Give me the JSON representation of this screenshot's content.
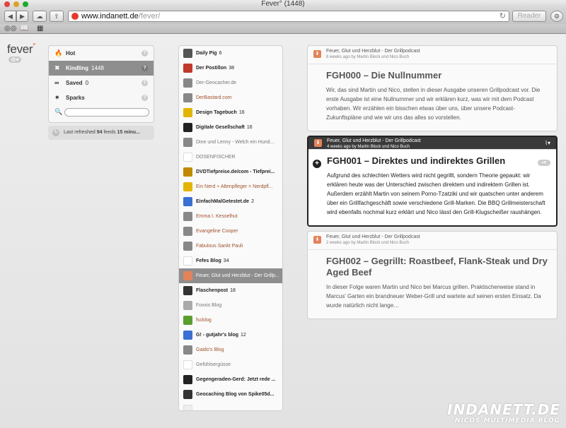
{
  "window": {
    "title": "Fever° (1448)",
    "url_host": "www.indanett.de",
    "url_path": "/fever/",
    "reader_label": "Reader"
  },
  "app": {
    "logo_text": "fever",
    "logo_mark": "°"
  },
  "nav": {
    "items": [
      {
        "label": "Hot",
        "icon": "flame-icon",
        "count": ""
      },
      {
        "label": "Kindling",
        "icon": "kindling-icon",
        "count": "1448"
      },
      {
        "label": "Saved",
        "icon": "saved-icon",
        "count": "0"
      },
      {
        "label": "Sparks",
        "icon": "sparks-icon",
        "count": ""
      }
    ],
    "help_glyph": "?",
    "search_placeholder": ""
  },
  "refresh": {
    "prefix": "Last refreshed ",
    "count": "94",
    "middle": " feeds ",
    "time": "15 minu..."
  },
  "feeds": [
    {
      "name": "Daily Pig",
      "count": "6",
      "bold": true,
      "style": "",
      "icon_color": "#555"
    },
    {
      "name": "Der Postillon",
      "count": "38",
      "bold": true,
      "style": "",
      "icon_color": "#c0392b"
    },
    {
      "name": "Der-Geocacher.de",
      "count": "",
      "bold": false,
      "style": "muted",
      "icon_color": "#888"
    },
    {
      "name": "DerBastard.com",
      "count": "",
      "bold": false,
      "style": "link",
      "icon_color": "#888"
    },
    {
      "name": "Design Tagebuch",
      "count": "16",
      "bold": true,
      "style": "",
      "icon_color": "#e2b400"
    },
    {
      "name": "Digitale Gesellschaft",
      "count": "16",
      "bold": true,
      "style": "",
      "icon_color": "#222"
    },
    {
      "name": "Dine und Lenny - Welch ein Hund...",
      "count": "",
      "bold": false,
      "style": "muted",
      "icon_color": "#888"
    },
    {
      "name": "DOSENFISCHER",
      "count": "",
      "bold": false,
      "style": "muted",
      "icon_color": "#fff"
    },
    {
      "name": "DVDTiefpreise.de/com - Tiefprei...",
      "count": "",
      "bold": true,
      "style": "",
      "icon_color": "#c08a00"
    },
    {
      "name": "Ein Nerd + Altenpfleger = Nerdpfl...",
      "count": "",
      "bold": false,
      "style": "link",
      "icon_color": "#e2b400"
    },
    {
      "name": "EinfachMalGetestet.de",
      "count": "2",
      "bold": true,
      "style": "",
      "icon_color": "#3b6fd1"
    },
    {
      "name": "Emma I. Kesselhut",
      "count": "",
      "bold": false,
      "style": "link",
      "icon_color": "#888"
    },
    {
      "name": "Evangeline Cooper",
      "count": "",
      "bold": false,
      "style": "link",
      "icon_color": "#888"
    },
    {
      "name": "Fabulous Sankt Pauli",
      "count": "",
      "bold": false,
      "style": "link",
      "icon_color": "#888"
    },
    {
      "name": "Fefes Blog",
      "count": "34",
      "bold": true,
      "style": "",
      "icon_color": "#fff"
    },
    {
      "name": "Feuer, Glut und Herzblut - Der Grillp...",
      "count": "",
      "bold": false,
      "style": "active",
      "icon_color": "#e3835b"
    },
    {
      "name": "Flaschenpost",
      "count": "18",
      "bold": true,
      "style": "",
      "icon_color": "#333"
    },
    {
      "name": "Foxxis Blog",
      "count": "",
      "bold": false,
      "style": "muted",
      "icon_color": "#aaa"
    },
    {
      "name": "fscklog",
      "count": "",
      "bold": false,
      "style": "link",
      "icon_color": "#5a9e2f"
    },
    {
      "name": "G! - gutjahr's blog",
      "count": "12",
      "bold": true,
      "style": "",
      "icon_color": "#3b6fd1"
    },
    {
      "name": "Gaido's Blog",
      "count": "",
      "bold": false,
      "style": "link",
      "icon_color": "#888"
    },
    {
      "name": "Gefühlsergüsse",
      "count": "",
      "bold": false,
      "style": "muted",
      "icon_color": "#fff"
    },
    {
      "name": "Gegengeraden-Gerd: Jetzt rede ...",
      "count": "",
      "bold": true,
      "style": "",
      "icon_color": "#222"
    },
    {
      "name": "Geocaching Blog von Spike05d...",
      "count": "",
      "bold": true,
      "style": "",
      "icon_color": "#333"
    },
    {
      "name": "",
      "count": "",
      "bold": false,
      "style": "muted",
      "icon_color": "#eee"
    }
  ],
  "articles": [
    {
      "feed": "Feuer, Glut und Herzblut - Der Grillpodcast",
      "meta": "8 weeks ago by Martin Block und Nico Buch",
      "title": "FGH000 – Die Nullnummer",
      "body": "Wir, das sind Martin und Nico, stellen in dieser Ausgabe unseren Grillpodcast vor. Die erste Ausgabe ist eine Nullnummer und wir erklären kurz, was wir mit dem Podcast vorhaben. Wir erzählen ein bisschen etwas über uns, über unsere Podcast-Zukunftspläne und wie wir uns das alles so vorstellen.",
      "selected": false
    },
    {
      "feed": "Feuer, Glut und Herzblut - Der Grillpodcast",
      "meta": "4 weeks ago by Martin Block und Nico Buch",
      "title": "FGH001 – Direktes und indirektes Grillen",
      "body": "Aufgrund des schlechten Wetters wird nicht gegrillt, sondern Theorie gepaukt: wir erklären heute was der Unterschied zwischen direktem und indirektem Grillen ist. Außerdem erzählt Martin von seinem Porno-Tzatziki und wir quatschen unter anderem über ein Grillfachgeschäft sowie verschiedene Grill-Marken. Die BBQ Grillmeisterschaft wird ebenfalls nochmal kurz erklärt und Nico lässt den Grill-Klugscheißer raushängen.",
      "selected": true
    },
    {
      "feed": "Feuer, Glut und Herzblut - Der Grillpodcast",
      "meta": "2 weeks ago by Martin Block und Nico Buch",
      "title": "FGH002 – Gegrillt: Roastbeef, Flank-Steak und Dry Aged Beef",
      "body": "In dieser Folge waren Martin und Nico bei Marcus grillen. Praktischerweise stand in Marcus' Garten ein brandneuer Weber-Grill und wartete auf seinen ersten Einsatz. Da wurde natürlich nicht lange…",
      "selected": false
    }
  ],
  "watermark": {
    "line1": "INDANETT.DE",
    "line2": "NICOS MULTIMEDIA BLOG"
  }
}
